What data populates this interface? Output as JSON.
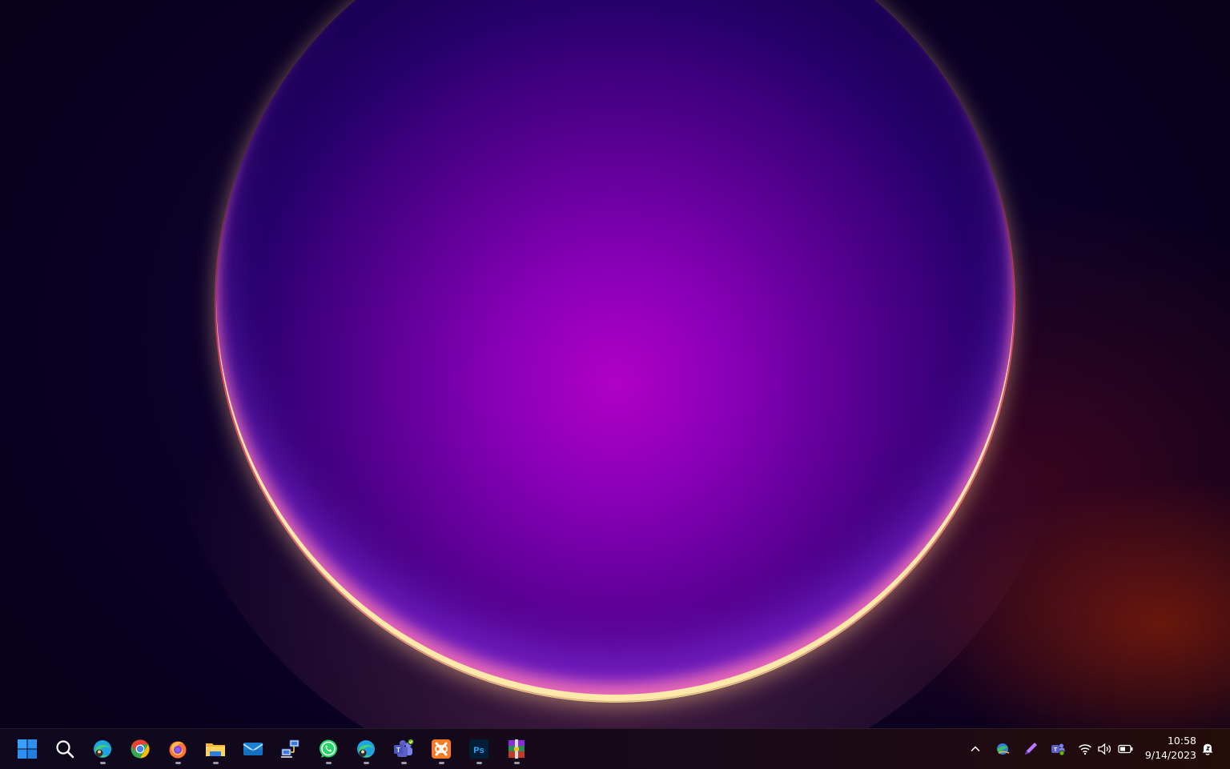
{
  "taskbar": {
    "apps": [
      {
        "name": "start-button",
        "icon": "windows-logo-icon",
        "running": false
      },
      {
        "name": "search-button",
        "icon": "search-icon",
        "running": false
      },
      {
        "name": "taskbar-edge-profile",
        "icon": "edge-icon",
        "running": true
      },
      {
        "name": "taskbar-chrome",
        "icon": "chrome-icon",
        "running": false
      },
      {
        "name": "taskbar-firefox",
        "icon": "firefox-icon",
        "running": true
      },
      {
        "name": "taskbar-file-explorer",
        "icon": "folder-icon",
        "running": true
      },
      {
        "name": "taskbar-mail",
        "icon": "mail-icon",
        "running": false
      },
      {
        "name": "taskbar-network-tool",
        "icon": "network-computers-icon",
        "running": false
      },
      {
        "name": "taskbar-whatsapp",
        "icon": "whatsapp-icon",
        "running": true
      },
      {
        "name": "taskbar-edge-profile-2",
        "icon": "edge-icon",
        "running": true
      },
      {
        "name": "taskbar-teams",
        "icon": "teams-icon",
        "running": true
      },
      {
        "name": "taskbar-xampp",
        "icon": "xampp-icon",
        "running": true
      },
      {
        "name": "taskbar-photoshop",
        "icon": "photoshop-icon",
        "running": true,
        "label": "Ps"
      },
      {
        "name": "taskbar-winrar",
        "icon": "winrar-icon",
        "running": true
      }
    ]
  },
  "tray": {
    "icons": [
      "chevron-up-icon",
      "google-earth-icon",
      "pen-icon",
      "teams-icon",
      "wifi-icon",
      "volume-icon",
      "battery-icon",
      "notification-icon"
    ],
    "time": "10:58",
    "date": "9/14/2023"
  },
  "colors": {
    "windows_blue": "#3aa0ff",
    "edge": "#1fa3e0",
    "chrome_red": "#ea4335",
    "chrome_yellow": "#fbbc05",
    "chrome_green": "#34a853",
    "whatsapp": "#25d366",
    "teams": "#5b5fc7",
    "xampp": "#fb7a24",
    "photoshop_bg": "#001e36",
    "photoshop_fg": "#31a8ff"
  }
}
